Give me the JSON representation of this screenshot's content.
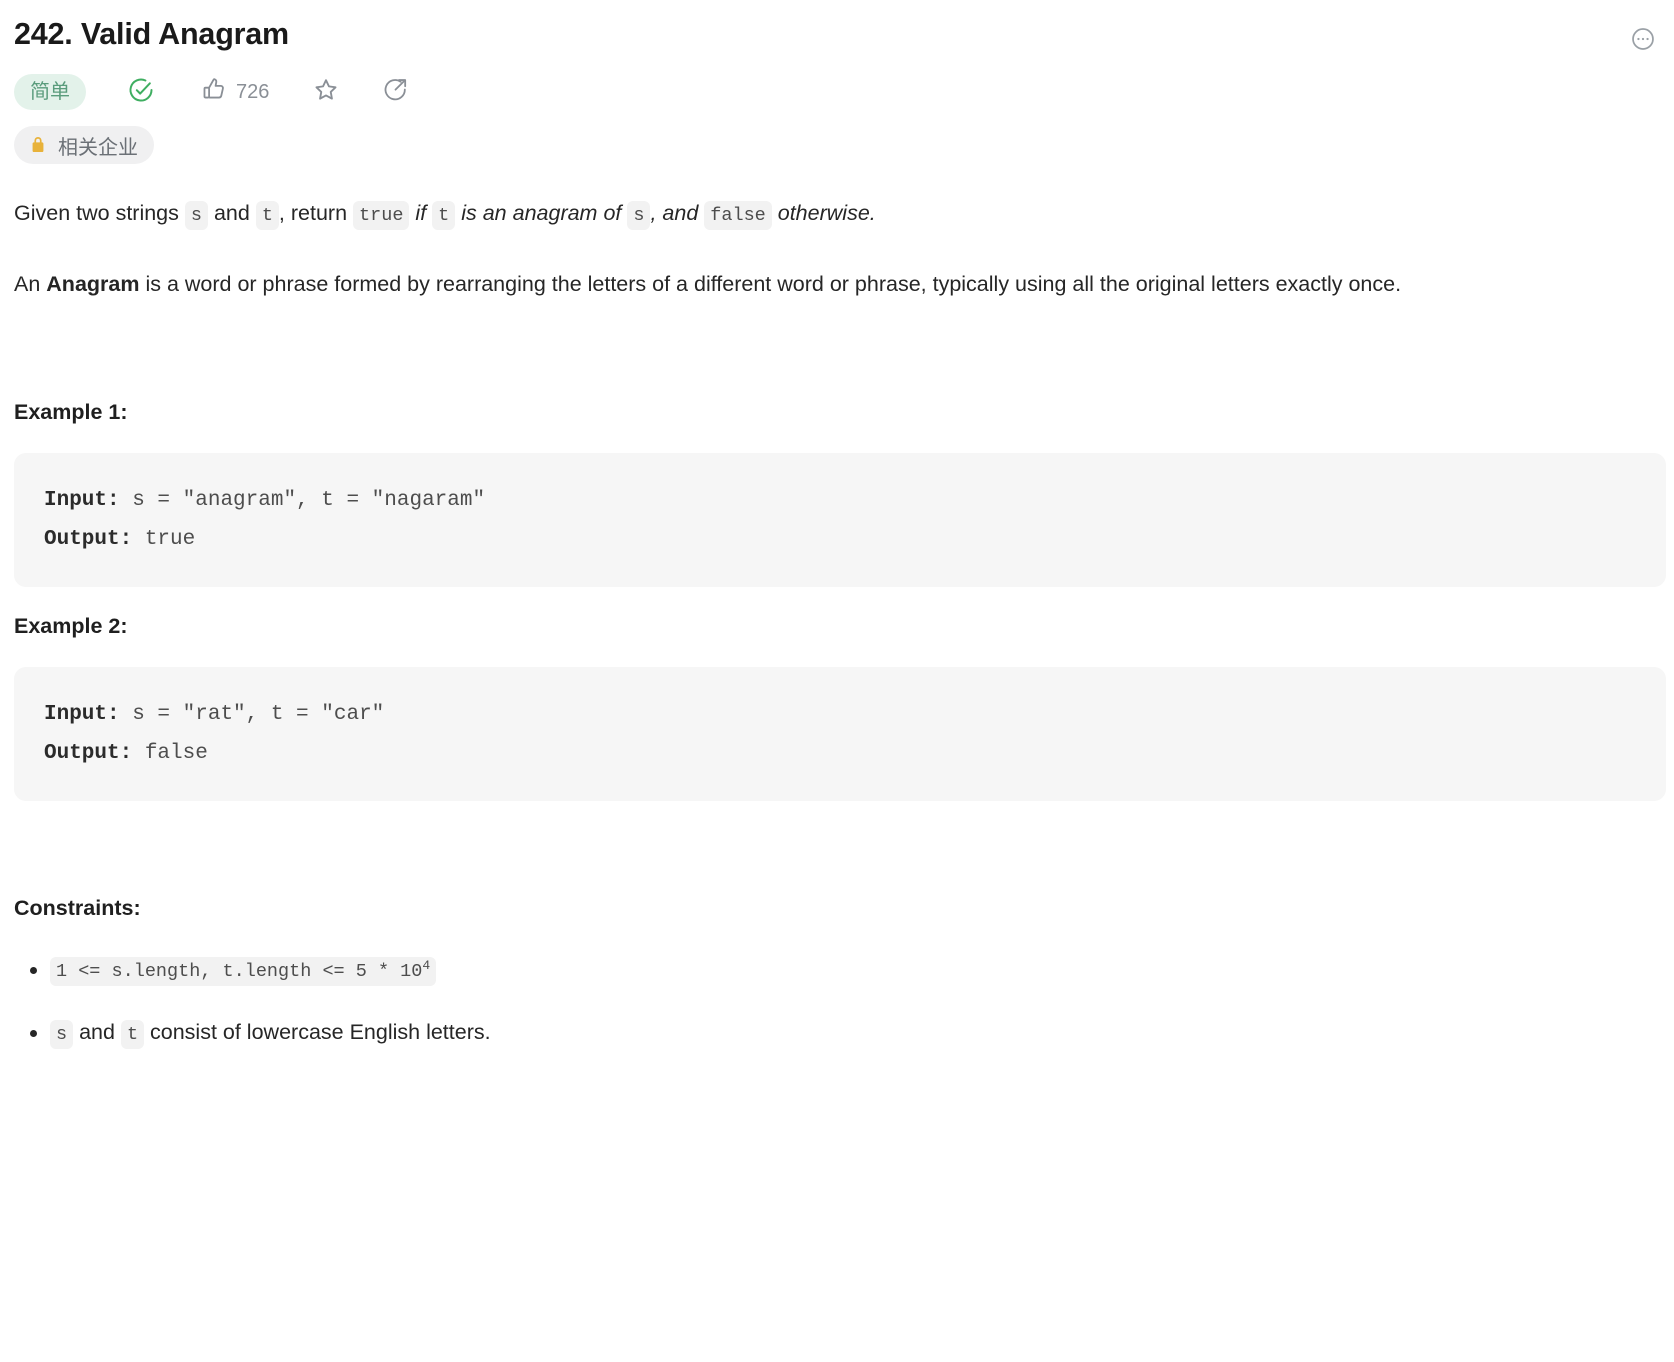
{
  "header": {
    "title": "242. Valid Anagram",
    "more_icon": "ellipsis-circle-icon"
  },
  "meta": {
    "difficulty": "简单",
    "accepted_icon": "check-circle-icon",
    "like_icon": "thumbs-up-icon",
    "like_count": "726",
    "star_icon": "star-icon",
    "share_icon": "share-circle-icon"
  },
  "company": {
    "lock_icon": "lock-icon",
    "label": "相关企业"
  },
  "description": {
    "p1": {
      "t1": "Given two strings ",
      "c1": "s",
      "t2": " and ",
      "c2": "t",
      "t3": ", return ",
      "c3": "true",
      "i1": " if ",
      "c4": "t",
      "i2": " is an anagram of ",
      "c5": "s",
      "i3": ", and ",
      "c6": "false",
      "i4": " otherwise."
    },
    "p2": {
      "t1": "An ",
      "b1": "Anagram",
      "t2": " is a word or phrase formed by rearranging the letters of a different word or phrase, typically using all the original letters exactly once."
    }
  },
  "examples": [
    {
      "heading": "Example 1:",
      "input_label": "Input:",
      "input_value": " s = \"anagram\", t = \"nagaram\"",
      "output_label": "Output:",
      "output_value": " true"
    },
    {
      "heading": "Example 2:",
      "input_label": "Input:",
      "input_value": " s = \"rat\", t = \"car\"",
      "output_label": "Output:",
      "output_value": " false"
    }
  ],
  "constraints": {
    "heading": "Constraints:",
    "item1": {
      "code_main": "1 <= s.length, t.length <= 5 * 10",
      "code_sup": "4"
    },
    "item2": {
      "c1": "s",
      "t1": " and ",
      "c2": "t",
      "t2": " consist of lowercase English letters."
    }
  },
  "colors": {
    "difficulty_bg": "#e3f2ea",
    "difficulty_fg": "#5a9c7c",
    "accepted_green": "#3fae61",
    "lock_gold": "#e8b23a",
    "code_bg": "#f6f6f6",
    "chip_bg": "#f2f2f2"
  }
}
